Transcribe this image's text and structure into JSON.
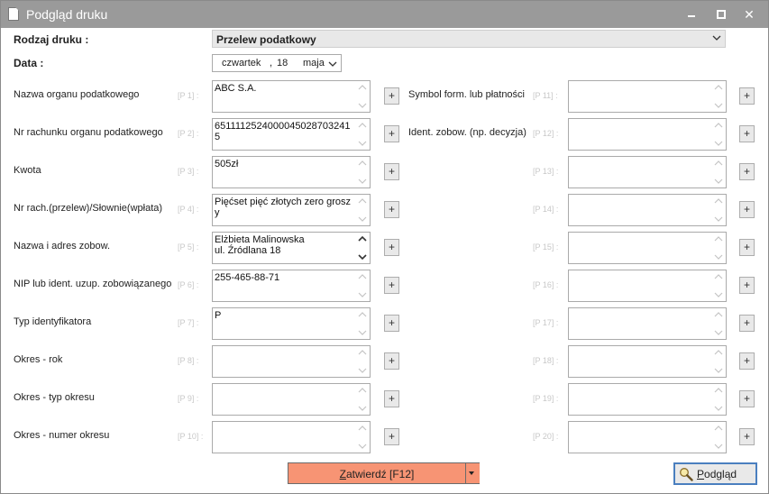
{
  "window": {
    "title": "Podgląd druku"
  },
  "header": {
    "print_type_label": "Rodzaj druku :",
    "print_type_value": "Przelew podatkowy",
    "date_label": "Data :",
    "date": {
      "weekday": "czwartek",
      "sep": ",",
      "day": "18",
      "month": "maja"
    }
  },
  "plus_label": "+",
  "left_fields": [
    {
      "label": "Nazwa organu podatkowego",
      "pnum": "[P 1] :",
      "value": "ABC S.A."
    },
    {
      "label": "Nr rachunku organu podatkowego",
      "pnum": "[P 2] :",
      "value": "65111125240000450287032415"
    },
    {
      "label": "Kwota",
      "pnum": "[P 3] :",
      "value": "505zł"
    },
    {
      "label": "Nr rach.(przelew)/Słownie(wpłata)",
      "pnum": "[P 4] :",
      "value": "Pięćset pięć złotych zero groszy"
    },
    {
      "label": "Nazwa i adres zobow.",
      "pnum": "[P 5] :",
      "value": "Elżbieta Malinowska\nul. Źródlana 18"
    },
    {
      "label": "NIP lub ident. uzup. zobowiązanego",
      "pnum": "[P 6] :",
      "value": "255-465-88-71"
    },
    {
      "label": "Typ identyfikatora",
      "pnum": "[P 7] :",
      "value": "P"
    },
    {
      "label": "Okres - rok",
      "pnum": "[P 8] :",
      "value": ""
    },
    {
      "label": "Okres - typ okresu",
      "pnum": "[P 9] :",
      "value": ""
    },
    {
      "label": "Okres - numer okresu",
      "pnum": "[P 10] :",
      "value": ""
    }
  ],
  "right_fields": [
    {
      "label": "Symbol form. lub płatności",
      "pnum": "[P 11] :",
      "value": ""
    },
    {
      "label": "Ident. zobow. (np. decyzja)",
      "pnum": "[P 12] :",
      "value": ""
    },
    {
      "label": "",
      "pnum": "[P 13] :",
      "value": ""
    },
    {
      "label": "",
      "pnum": "[P 14] :",
      "value": ""
    },
    {
      "label": "",
      "pnum": "[P 15] :",
      "value": ""
    },
    {
      "label": "",
      "pnum": "[P 16] :",
      "value": ""
    },
    {
      "label": "",
      "pnum": "[P 17] :",
      "value": ""
    },
    {
      "label": "",
      "pnum": "[P 18] :",
      "value": ""
    },
    {
      "label": "",
      "pnum": "[P 19] :",
      "value": ""
    },
    {
      "label": "",
      "pnum": "[P 20] :",
      "value": ""
    }
  ],
  "footer": {
    "confirm_prefix": "Z",
    "confirm_rest": "atwierdź [F12]",
    "preview_prefix": "P",
    "preview_rest": "odgląd"
  },
  "colors": {
    "confirm_bg": "#f79474",
    "titlebar": "#9a9a9a",
    "preview_border": "#4a7fbf"
  },
  "icons": {
    "app": "document-icon",
    "preview": "magnifier-icon"
  }
}
